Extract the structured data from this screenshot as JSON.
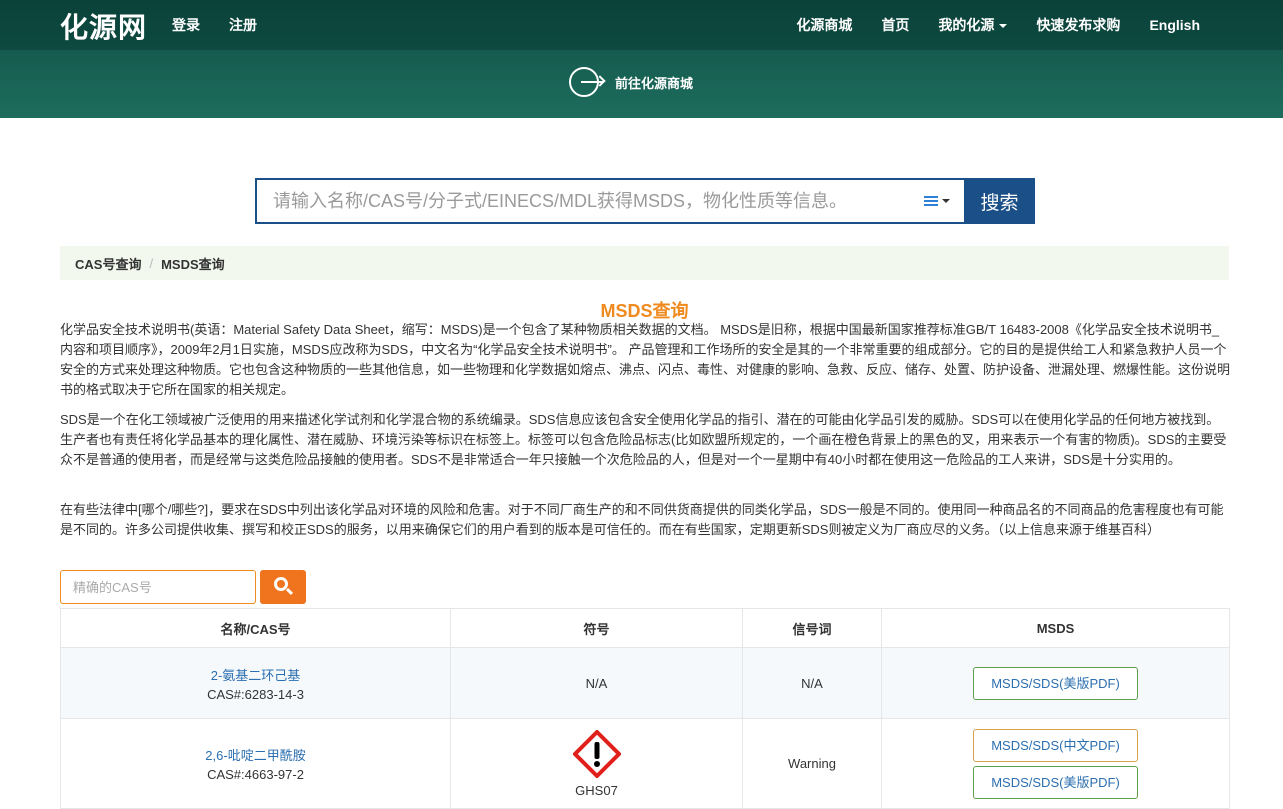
{
  "header": {
    "logo_part1": "化",
    "logo_part2": "源网",
    "nav_left": [
      "登录",
      "注册"
    ],
    "nav_right": [
      "化源商城",
      "首页",
      "我的化源",
      "快速发布求购",
      "English"
    ],
    "goto_label": "前往化源商城"
  },
  "search": {
    "placeholder": "请输入名称/CAS号/分子式/EINECS/MDL获得MSDS，物化性质等信息。",
    "button": "搜索"
  },
  "breadcrumb": [
    "CAS号查询",
    "MSDS查询"
  ],
  "title": "MSDS查询",
  "paragraphs": [
    "化学品安全技术说明书(英语：Material Safety Data Sheet，缩写：MSDS)是一个包含了某种物质相关数据的文档。 MSDS是旧称，根据中国最新国家推荐标准GB/T 16483-2008《化学品安全技术说明书_内容和项目顺序》，2009年2月1日实施，MSDS应改称为SDS，中文名为“化学品安全技术说明书”。 产品管理和工作场所的安全是其的一个非常重要的组成部分。它的目的是提供给工人和紧急救护人员一个安全的方式来处理这种物质。它也包含这种物质的一些其他信息，如一些物理和化学数据如熔点、沸点、闪点、毒性、对健康的影响、急救、反应、储存、处置、防护设备、泄漏处理、燃爆性能。这份说明书的格式取决于它所在国家的相关规定。",
    "SDS是一个在化工领域被广泛使用的用来描述化学试剂和化学混合物的系统编录。SDS信息应该包含安全使用化学品的指引、潜在的可能由化学品引发的威胁。SDS可以在使用化学品的任何地方被找到。生产者也有责任将化学品基本的理化属性、潜在威胁、环境污染等标识在标签上。标签可以包含危险品标志(比如欧盟所规定的，一个画在橙色背景上的黑色的叉，用来表示一个有害的物质)。SDS的主要受众不是普通的使用者，而是经常与这类危险品接触的使用者。SDS不是非常适合一年只接触一个次危险品的人，但是对一个一星期中有40小时都在使用这一危险品的工人来讲，SDS是十分实用的。",
    "在有些法律中[哪个/哪些?]，要求在SDS中列出该化学品对环境的风险和危害。对于不同厂商生产的和不同供货商提供的同类化学品，SDS一般是不同的。使用同一种商品名的不同商品的危害程度也有可能是不同的。许多公司提供收集、撰写和校正SDS的服务，以用来确保它们的用户看到的版本是可信任的。而在有些国家，定期更新SDS则被定义为厂商应尽的义务。（以上信息来源于维基百科）"
  ],
  "cas_search": {
    "placeholder": "精确的CAS号"
  },
  "table": {
    "headers": [
      "名称/CAS号",
      "符号",
      "信号词",
      "MSDS"
    ],
    "rows": [
      {
        "name": "2-氨基二环己基",
        "cas": "CAS#:6283-14-3",
        "symbol": "N/A",
        "signal": "N/A",
        "msds": [
          "MSDS/SDS(美版PDF)"
        ]
      },
      {
        "name": "2,6-吡啶二甲酰胺",
        "cas": "CAS#:4663-97-2",
        "symbol": "GHS07",
        "signal": "Warning",
        "msds": [
          "MSDS/SDS(中文PDF)",
          "MSDS/SDS(美版PDF)"
        ]
      }
    ]
  }
}
